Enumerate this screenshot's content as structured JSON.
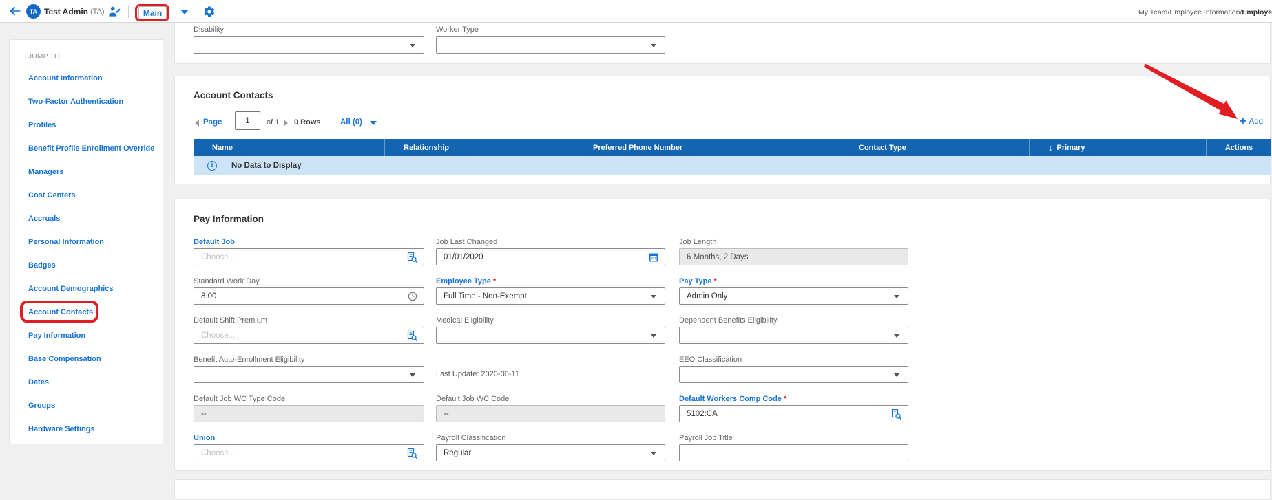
{
  "colors": {
    "accent_blue": "#1874d2",
    "table_header_blue": "#1365b2",
    "annotation_red": "#e11d24",
    "empty_row_blue": "#cde4f7"
  },
  "topbar": {
    "avatar_initials": "TA",
    "user_name": "Test Admin",
    "user_suffix": "(TA)",
    "main_tab": "Main",
    "breadcrumb_prefix": "My Team/Employee Information/",
    "breadcrumb_current": "Employee Pr"
  },
  "sidebar": {
    "jump_to": "JUMP TO",
    "items": [
      {
        "label": "Account Information"
      },
      {
        "label": "Two-Factor Authentication"
      },
      {
        "label": "Profiles"
      },
      {
        "label": "Benefit Profile Enrollment Override"
      },
      {
        "label": "Managers"
      },
      {
        "label": "Cost Centers"
      },
      {
        "label": "Accruals"
      },
      {
        "label": "Personal Information"
      },
      {
        "label": "Badges"
      },
      {
        "label": "Account Demographics"
      },
      {
        "label": "Account Contacts"
      },
      {
        "label": "Pay Information"
      },
      {
        "label": "Base Compensation"
      },
      {
        "label": "Dates"
      },
      {
        "label": "Groups"
      },
      {
        "label": "Hardware Settings"
      }
    ]
  },
  "top_form": {
    "disability_label": "Disability",
    "worker_type_label": "Worker Type"
  },
  "account_contacts": {
    "title": "Account Contacts",
    "pagination": {
      "page_label": "Page",
      "page_value": "1",
      "of_label": "of 1",
      "rows_label": "0 Rows",
      "filter_label": "All (0)"
    },
    "add_label": "Add",
    "sort_icon": "↓",
    "columns": [
      {
        "label": "Name"
      },
      {
        "label": "Relationship"
      },
      {
        "label": "Preferred Phone Number"
      },
      {
        "label": "Contact Type"
      },
      {
        "label": "Primary"
      },
      {
        "label": "Actions"
      }
    ],
    "empty_message": "No Data to Display"
  },
  "pay_information": {
    "title": "Pay Information",
    "required_marker": "*",
    "fields": {
      "default_job": {
        "label": "Default Job",
        "placeholder": "Choose..."
      },
      "job_last_changed": {
        "label": "Job Last Changed",
        "value": "01/01/2020"
      },
      "job_length": {
        "label": "Job Length",
        "value": "6 Months, 2 Days"
      },
      "standard_work_day": {
        "label": "Standard Work Day",
        "value": "8.00"
      },
      "employee_type": {
        "label": "Employee Type",
        "value": "Full Time - Non-Exempt"
      },
      "pay_type": {
        "label": "Pay Type",
        "value": "Admin Only"
      },
      "default_shift_premium": {
        "label": "Default Shift Premium",
        "placeholder": "Choose..."
      },
      "medical_eligibility": {
        "label": "Medical Eligibility",
        "value": ""
      },
      "dependent_benefits_eligibility": {
        "label": "Dependent Benefits Eligibility",
        "value": ""
      },
      "benefit_auto_enrollment": {
        "label": "Benefit Auto-Enrollment Eligibility",
        "value": ""
      },
      "last_update_note": "Last Update: 2020-06-11",
      "eeo_classification": {
        "label": "EEO Classification",
        "value": ""
      },
      "default_job_wc_type_code": {
        "label": "Default Job WC Type Code",
        "value": "--"
      },
      "default_job_wc_code": {
        "label": "Default Job WC Code",
        "value": "--"
      },
      "default_workers_comp_code": {
        "label": "Default Workers Comp Code",
        "value": "5102:CA"
      },
      "union": {
        "label": "Union",
        "placeholder": "Choose..."
      },
      "payroll_classification": {
        "label": "Payroll Classification",
        "value": "Regular"
      },
      "payroll_job_title": {
        "label": "Payroll Job Title",
        "value": ""
      }
    }
  }
}
